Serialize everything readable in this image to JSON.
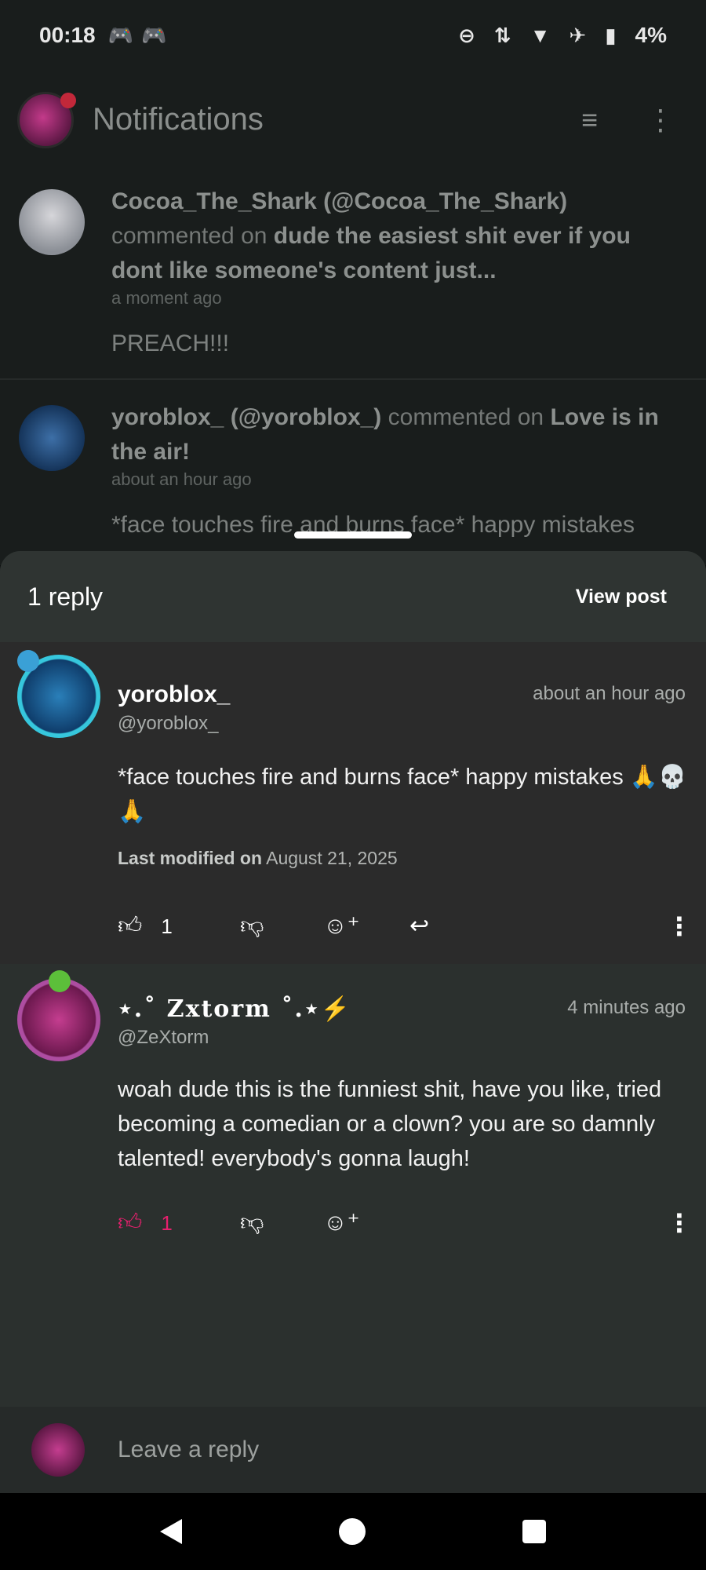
{
  "status_bar": {
    "time": "00:18",
    "battery": "4%",
    "icons": [
      "game-controller-icon",
      "game-controller-icon",
      "do-not-disturb-icon",
      "data-arrows-icon",
      "wifi-icon",
      "airplane-icon",
      "battery-charging-icon"
    ]
  },
  "app_bar": {
    "title": "Notifications",
    "filter_icon": "filter-icon",
    "more_icon": "more-vertical-icon"
  },
  "notifications": [
    {
      "user": "Cocoa_The_Shark (@Cocoa_The_Shark)",
      "action": "commented on",
      "target": "dude the easiest shit ever if you dont like someone's content just...",
      "time": "a moment ago",
      "message": "PREACH!!!"
    },
    {
      "user": "yoroblox_ (@yoroblox_)",
      "action": "commented on",
      "target": "Love is in the air!",
      "time": "about an hour ago",
      "message": "*face touches fire and burns face* happy mistakes"
    }
  ],
  "sheet": {
    "reply_count": "1 reply",
    "view_post": "View post"
  },
  "comments": [
    {
      "name": "yoroblox_",
      "handle": "@yoroblox_",
      "time": "about an hour ago",
      "body": "*face touches fire and burns face* happy mistakes 🙏💀🙏",
      "modified_label": "Last modified on",
      "modified_date": "August 21, 2025",
      "likes": "1",
      "liked": false
    },
    {
      "name": "⋆.˚ 𝐙𝐱𝐭𝐨𝐫𝐦 ˚.⋆⚡",
      "handle": "@ZeXtorm",
      "time": "4 minutes ago",
      "body": "woah dude this is the funniest shit, have you like, tried becoming a comedian or a clown? you are so damnly talented! everybody's gonna laugh!",
      "likes": "1",
      "liked": true
    }
  ],
  "reply_bar": {
    "placeholder": "Leave a reply"
  },
  "colors": {
    "liked_accent": "#e5206d",
    "sheet_bg": "#2b302e",
    "comment1_bg": "#2b2b2b"
  }
}
